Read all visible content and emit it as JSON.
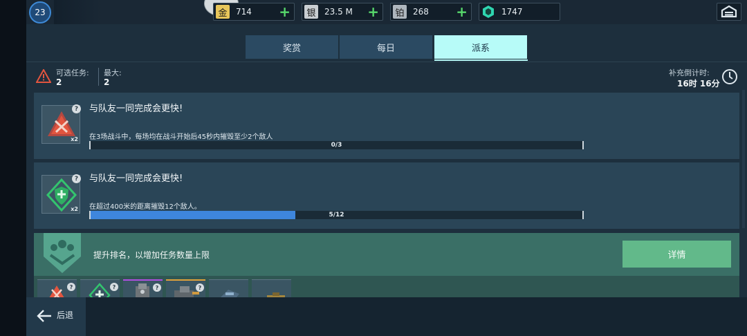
{
  "header": {
    "level": "23",
    "currencies": [
      {
        "name": "gold",
        "icon_char": "金",
        "value": "714",
        "color": "#e8c65a"
      },
      {
        "name": "silver",
        "icon_char": "银",
        "value": "23.5 M",
        "color": "#c9ced2"
      },
      {
        "name": "platinum",
        "icon_char": "铂",
        "value": "268",
        "color": "#aeb6bd"
      },
      {
        "name": "crystal",
        "icon_char": "",
        "value": "1747",
        "color": "#2fd6b0"
      }
    ]
  },
  "tabs": [
    {
      "label": "奖赏",
      "active": false
    },
    {
      "label": "每日",
      "active": false
    },
    {
      "label": "派系",
      "active": true
    }
  ],
  "info": {
    "available_label": "可选任务:",
    "available_value": "2",
    "max_label": "最大:",
    "max_value": "2",
    "refill_label": "补充倒计时:",
    "refill_value": "16时 16分"
  },
  "missions": [
    {
      "title": "与队友一同完成会更快!",
      "desc": "在3场战斗中，每场均在战斗开始后45秒内摧毁至少2个敌人",
      "multiplier": "x2",
      "progress": 0,
      "total": 3,
      "progress_text": "0/3",
      "badge_color": "#e2553f",
      "icon": "crossed-swords-icon"
    },
    {
      "title": "与队友一同完成会更快!",
      "desc": "在超过400米的距离摧毁12个敌人。",
      "multiplier": "x2",
      "progress": 5,
      "total": 12,
      "progress_text": "5/12",
      "badge_color": "#33c46e",
      "icon": "shield-plus-icon"
    }
  ],
  "rank": {
    "text": "提升排名，以增加任务数量上限",
    "button_label": "详情"
  },
  "footer": {
    "back_label": "后退"
  },
  "colors": {
    "accent_tab": "#b7fbf8",
    "progress_fill": "#3e86dd",
    "rank_panel": "#3a6f66",
    "details_button": "#62b98a",
    "plus": "#57d86b"
  }
}
